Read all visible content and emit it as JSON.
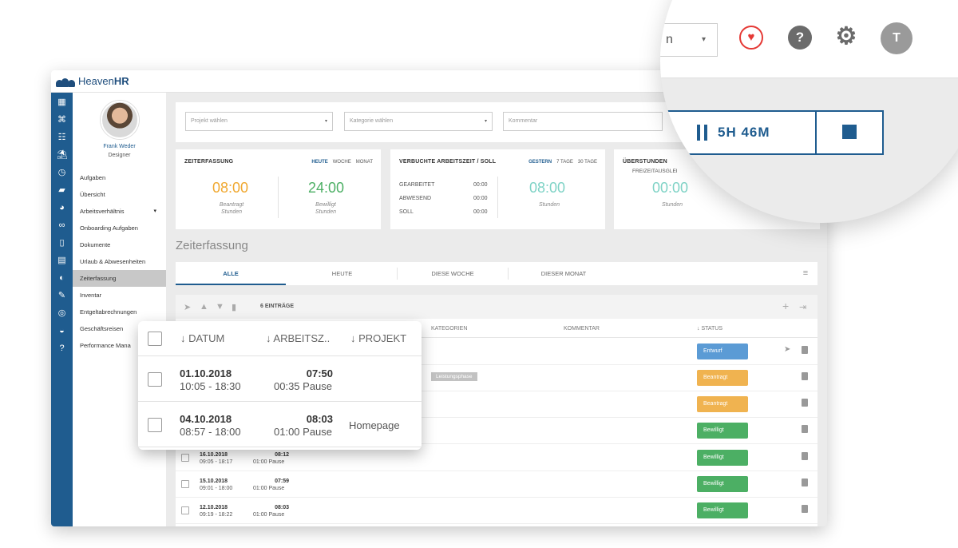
{
  "app": {
    "logo_prefix": "Heaven",
    "logo_suffix": "HR"
  },
  "user": {
    "name": "Frank Weder",
    "role": "Designer"
  },
  "nav": [
    {
      "label": "Aufgaben"
    },
    {
      "label": "Übersicht"
    },
    {
      "label": "Arbeitsverhältnis",
      "caret": "▾"
    },
    {
      "label": "Onboarding Aufgaben"
    },
    {
      "label": "Dokumente"
    },
    {
      "label": "Urlaub & Abwesenheiten"
    },
    {
      "label": "Zeiterfassung",
      "active": true
    },
    {
      "label": "Inventar"
    },
    {
      "label": "Entgeltabrechnungen"
    },
    {
      "label": "Geschäftsreisen"
    },
    {
      "label": "Performance Mana"
    }
  ],
  "filters": {
    "projekt": "Projekt wählen",
    "kategorie": "Kategorie wählen",
    "kommentar": "Kommentar",
    "arrow": "▾"
  },
  "cards": {
    "zeiterfassung": {
      "title": "ZEITERFASSUNG",
      "tabs": [
        "HEUTE",
        "WOCHE",
        "MONAT"
      ],
      "left_value": "08:00",
      "left_label_1": "Beantragt",
      "left_label_2": "Stunden",
      "right_value": "24:00",
      "right_label_1": "Bewilligt",
      "right_label_2": "Stunden"
    },
    "verbucht": {
      "title": "VERBUCHTE ARBEITSZEIT / SOLL",
      "tabs": [
        "GESTERN",
        "7 TAGE",
        "30 TAGE"
      ],
      "rows": [
        {
          "label": "GEARBEITET",
          "value": "00:00"
        },
        {
          "label": "ABWESEND",
          "value": "00:00"
        },
        {
          "label": "SOLL",
          "value": "00:00"
        }
      ],
      "big_value": "08:00",
      "big_label": "Stunden"
    },
    "ueberstunden": {
      "title": "ÜBERSTUNDEN",
      "sub_title": "FREIZEITAUSGLEI",
      "value": "00:00",
      "label": "Stunden"
    }
  },
  "section_title": "Zeiterfassung",
  "tabs": [
    "ALLE",
    "HEUTE",
    "DIESE WOCHE",
    "DIESER MONAT"
  ],
  "list": {
    "count": "6 EINTRÄGE",
    "headers": {
      "kategorien": "KATEGORIEN",
      "kommentar": "KOMMENTAR",
      "status": "↓ STATUS"
    },
    "rows": [
      {
        "date": "",
        "time": "",
        "hours": "",
        "pause": "",
        "kategorie": "",
        "status": "Entwurf",
        "color": "#5b9bd5",
        "send": true
      },
      {
        "date": "",
        "time": "",
        "hours": "",
        "pause": "",
        "kategorie": "Leistungsphase",
        "status": "Beantragt",
        "color": "#f0b350"
      },
      {
        "date": "",
        "time": "",
        "hours": "",
        "pause": "",
        "kategorie": "",
        "status": "Beantragt",
        "color": "#f0b350"
      },
      {
        "date": "",
        "time": "",
        "hours": "",
        "pause": "",
        "kategorie": "",
        "status": "Bewilligt",
        "color": "#4caf64"
      },
      {
        "date": "16.10.2018",
        "time": "09:05 - 18:17",
        "hours": "08:12",
        "pause": "01:00 Pause",
        "kategorie": "",
        "status": "Bewilligt",
        "color": "#4caf64"
      },
      {
        "date": "15.10.2018",
        "time": "09:01 - 18:00",
        "hours": "07:59",
        "pause": "01:00 Pause",
        "kategorie": "",
        "status": "Bewilligt",
        "color": "#4caf64"
      },
      {
        "date": "12.10.2018",
        "time": "09:19 - 18:22",
        "hours": "08:03",
        "pause": "01:00 Pause",
        "kategorie": "",
        "status": "Bewilligt",
        "color": "#4caf64"
      }
    ]
  },
  "zoom": {
    "headers": {
      "datum": "↓ DATUM",
      "arbeitszeit": "↓ ARBEITSZ..",
      "projekt": "↓ PROJEKT"
    },
    "rows": [
      {
        "date": "01.10.2018",
        "time": "10:05 - 18:30",
        "hours": "07:50",
        "pause": "00:35 Pause",
        "projekt": ""
      },
      {
        "date": "04.10.2018",
        "time": "08:57 - 18:00",
        "hours": "08:03",
        "pause": "01:00 Pause",
        "projekt": "Homepage"
      }
    ]
  },
  "magnifier": {
    "select_text": "n",
    "select_arrow": "▾",
    "help": "?",
    "avatar_initial": "T",
    "timer": "5H 46M",
    "heart_color": "#e53935",
    "accent": "#1f5c8f"
  }
}
